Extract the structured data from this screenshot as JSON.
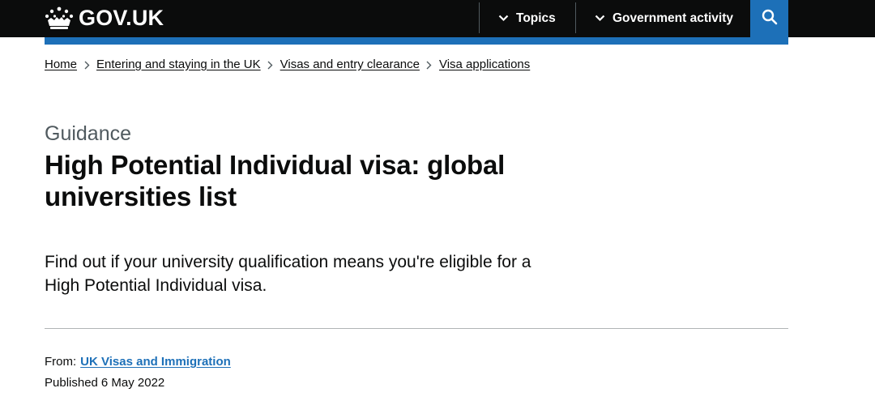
{
  "header": {
    "logo_text": "GOV.UK",
    "nav": [
      {
        "label": "Topics",
        "icon": "chevron-down-icon"
      },
      {
        "label": "Government activity",
        "icon": "chevron-down-icon"
      }
    ],
    "search_icon": "search-icon",
    "colors": {
      "header_bg": "#0b0c0c",
      "accent_blue": "#1d70b8"
    }
  },
  "breadcrumb": [
    "Home",
    "Entering and staying in the UK",
    "Visas and entry clearance",
    "Visa applications"
  ],
  "page": {
    "caption": "Guidance",
    "title": "High Potential Individual visa: global universities list",
    "lead": "Find out if your university qualification means you're eligible for a High Potential Individual visa.",
    "from_label": "From:",
    "from_org": "UK Visas and Immigration",
    "published_label": "Published",
    "published_date": "6 May 2022"
  }
}
